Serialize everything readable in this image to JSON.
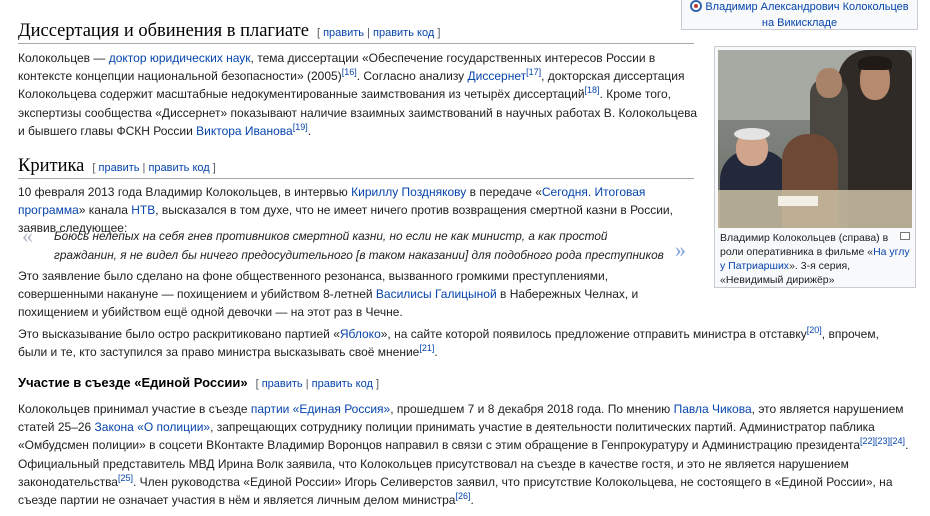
{
  "commons": {
    "line1": "Владимир Александрович Колокольцев",
    "line2": "на Викискладе"
  },
  "thumb": {
    "caption_pre": "Владимир Колокольцев (справа) в роли оперативника в фильме «",
    "caption_link": "На углу у Патриарших",
    "caption_post": "». 3-я серия, «Невидимый дирижёр»"
  },
  "edit_labels": {
    "edit": "править",
    "edit_code": "править код",
    "sep": "|",
    "open": "[",
    "close": "]"
  },
  "sections": {
    "dissertation": {
      "title": "Диссертация и обвинения в плагиате",
      "t1": "Колокольцев — ",
      "l1": "доктор юридических наук",
      "t2": ", тема диссертации «Обеспечение государственных интересов России в контексте концепции национальной безопасности» (2005)",
      "r1": "[16]",
      "t3": ". Согласно анализу ",
      "l2": "Диссернет",
      "r2": "[17]",
      "t4": ", докторская диссертация Колокольцева содержит масштабные недокументированные заимствования из четырёх диссертаций",
      "r3": "[18]",
      "t5": ". Кроме того, экспертизы сообщества «Диссернет» показывают наличие взаимных заимствований в научных работах В. Колокольцева и бывшего главы ФСКН России ",
      "l3": "Виктора Иванова",
      "r4": "[19]",
      "t6": "."
    },
    "criticism": {
      "title": "Критика",
      "p1_t1": "10 февраля 2013 года Владимир Колокольцев, в интервью ",
      "p1_l1": "Кириллу Позднякову",
      "p1_t2": " в передаче «",
      "p1_l2": "Сегодня. Итоговая программа",
      "p1_t3": "» канала ",
      "p1_l3": "НТВ",
      "p1_t4": ", высказался в том духе, что не имеет ничего против возвращения смертной казни в России, заявив следующее:",
      "quote": "Боюсь нелепых на себя гнев противников смертной казни, но если не как министр, а как простой гражданин, я не видел бы ничего предосудительного [в таком наказании] для подобного рода преступников",
      "quote_open": "«",
      "quote_close": "»",
      "p2_t1": "Это заявление было сделано на фоне общественного резонанса, вызванного громкими преступлениями, совершенными накануне — похищением и убийством 8-летней ",
      "p2_l1": "Василисы Галицыной",
      "p2_t2": " в Набережных Челнах, и похищением и убийством ещё одной девочки — на этот раз в Чечне.",
      "p3_t1": "Это высказывание было остро раскритиковано партией «",
      "p3_l1": "Яблоко",
      "p3_t2": "», на сайте которой появилось предложение отправить министра в отставку",
      "p3_r1": "[20]",
      "p3_t3": ", впрочем, были и те, кто заступился за право министра высказывать своё мнение",
      "p3_r2": "[21]",
      "p3_t4": "."
    },
    "congress": {
      "title": "Участие в съезде «Единой России»",
      "t1": "Колокольцев принимал участие в съезде ",
      "l1": "партии «Единая Россия»",
      "t2": ", прошедшем 7 и 8 декабря 2018 года. По мнению ",
      "l2": "Павла Чикова",
      "t3": ", это является нарушением статей 25–26 ",
      "l3": "Закона «О полиции»",
      "t4": ", запрещающих сотруднику полиции принимать участие в деятельности политических партий. Администратор паблика «Омбудсмен полиции» в соцсети ВКонтакте Владимир Воронцов направил в связи с этим обращение в Генпрокуратуру и Администрацию президента",
      "r1": "[22]",
      "r2": "[23]",
      "r3": "[24]",
      "t5": ". Официальный представитель МВД Ирина Волк заявила, что Колокольцев присутствовал на съезде в качестве гостя, и это не является нарушением законодательства",
      "r4": "[25]",
      "t6": ". Член руководства «Единой России» Игорь Селиверстов заявил, что присутствие Колокольцева, не состоящего в «Единой России», на съезде партии не означает участия в нём и является личным делом министра",
      "r5": "[26]",
      "t7": "."
    }
  },
  "colors": {
    "link": "#0645ad",
    "text": "#202122",
    "rule": "#a2a9b1",
    "quote_mark": "#7fa4dd"
  }
}
